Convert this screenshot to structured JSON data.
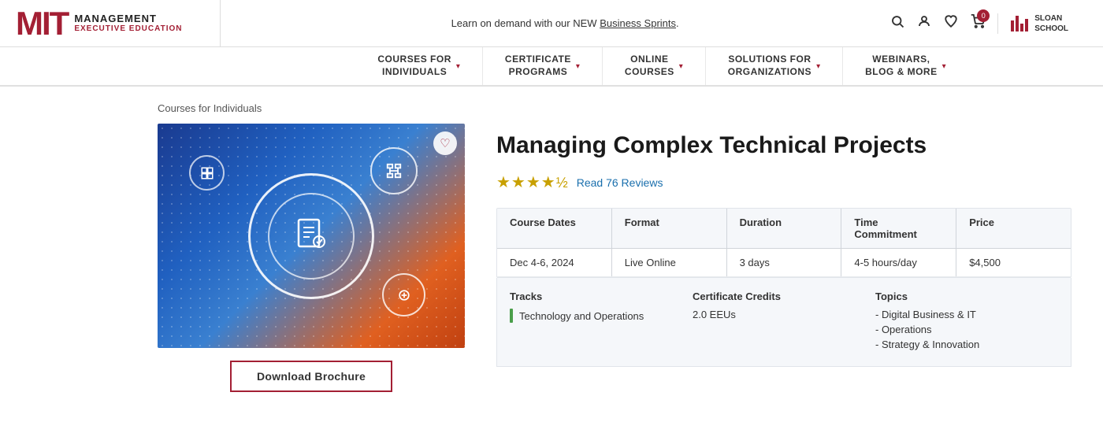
{
  "header": {
    "banner_message": "Learn on demand with our NEW ",
    "banner_link": "Business Sprints",
    "logo_mit": "MIT",
    "logo_management": "MANAGEMENT",
    "logo_exec": "EXECUTIVE EDUCATION",
    "sloan_line1": "SLOAN",
    "sloan_line2": "SCHOOL",
    "cart_count": "0"
  },
  "nav": {
    "items": [
      {
        "label": "COURSES FOR\nINDIVIDUALS",
        "has_chevron": true
      },
      {
        "label": "CERTIFICATE\nPROGRAMS",
        "has_chevron": true
      },
      {
        "label": "ONLINE\nCOURSES",
        "has_chevron": true
      },
      {
        "label": "SOLUTIONS FOR\nORGANIZATIONS",
        "has_chevron": true
      },
      {
        "label": "WEBINARS,\nBLOG & MORE",
        "has_chevron": true
      }
    ]
  },
  "breadcrumb": "Courses for Individuals",
  "course": {
    "title": "Managing Complex Technical Projects",
    "rating_stars": "★★★★",
    "rating_half": "½",
    "reviews_text": "Read 76 Reviews",
    "table": {
      "headers": [
        "Course Dates",
        "Format",
        "Duration",
        "Time Commitment",
        "Price"
      ],
      "row": [
        "Dec 4-6, 2024",
        "Live Online",
        "3 days",
        "4-5 hours/day",
        "$4,500"
      ]
    },
    "tracks_label": "Tracks",
    "track_name": "Technology and Operations",
    "credits_label": "Certificate Credits",
    "credits_value": "2.0 EEUs",
    "topics_label": "Topics",
    "topics": [
      "- Digital Business & IT",
      "- Operations",
      "- Strategy & Innovation"
    ],
    "download_btn": "Download Brochure",
    "heart_icon": "♡"
  }
}
